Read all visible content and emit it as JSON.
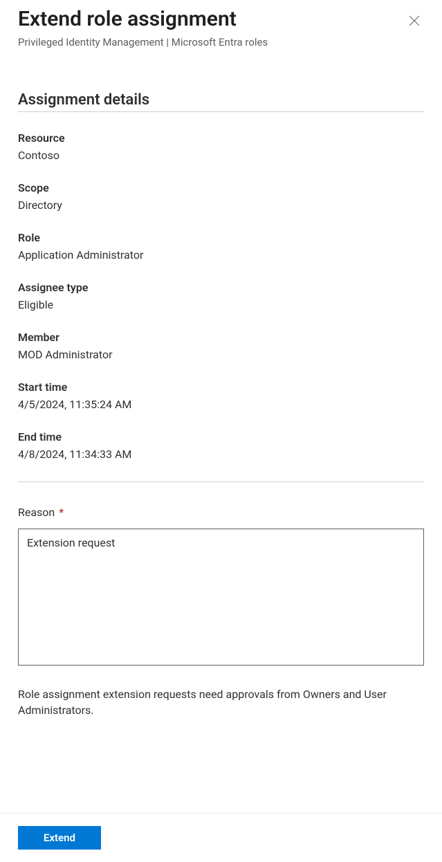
{
  "header": {
    "title": "Extend role assignment",
    "subtitle": "Privileged Identity Management | Microsoft Entra roles"
  },
  "section": {
    "title": "Assignment details"
  },
  "details": {
    "resource": {
      "label": "Resource",
      "value": "Contoso"
    },
    "scope": {
      "label": "Scope",
      "value": "Directory"
    },
    "role": {
      "label": "Role",
      "value": "Application Administrator"
    },
    "assignee_type": {
      "label": "Assignee type",
      "value": "Eligible"
    },
    "member": {
      "label": "Member",
      "value": "MOD Administrator"
    },
    "start_time": {
      "label": "Start time",
      "value": "4/5/2024, 11:35:24 AM"
    },
    "end_time": {
      "label": "End time",
      "value": "4/8/2024, 11:34:33 AM"
    }
  },
  "reason": {
    "label": "Reason",
    "required_marker": "*",
    "value": "Extension request"
  },
  "info_text": "Role assignment extension requests need approvals from Owners and User Administrators.",
  "footer": {
    "extend_label": "Extend"
  }
}
